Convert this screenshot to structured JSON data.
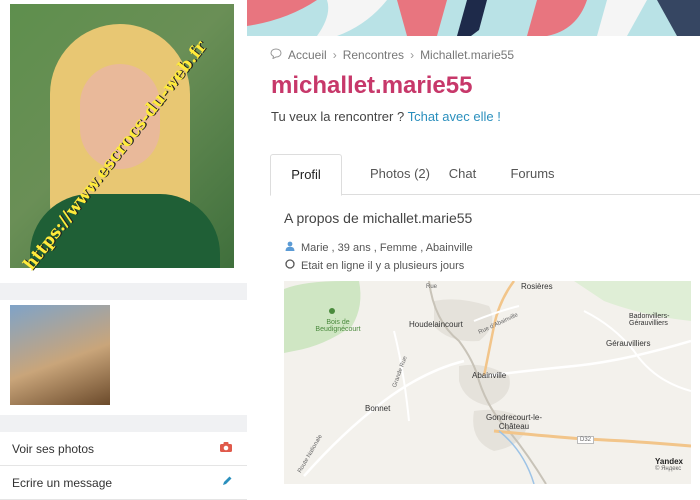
{
  "sidebar": {
    "watermark": "https://www.escrocs-du-web.fr",
    "actions": [
      {
        "label": "Voir ses photos",
        "icon": "camera-icon",
        "icon_color": "#e05a4b"
      },
      {
        "label": "Ecrire un message",
        "icon": "pencil-icon",
        "icon_color": "#2a8fbd"
      }
    ]
  },
  "breadcrumb": [
    "Accueil",
    "Rencontres",
    "Michallet.marie55"
  ],
  "profile": {
    "username": "michallet.marie55",
    "prompt": "Tu veux la rencontrer ?",
    "chat_link": "Tchat avec elle !",
    "about_title": "A propos de michallet.marie55",
    "details": "Marie , 39 ans , Femme , Abainville",
    "status": "Etait en ligne il y a plusieurs jours"
  },
  "tabs": [
    {
      "label": "Profil",
      "active": true
    },
    {
      "label": "Photos (2)",
      "active": false
    },
    {
      "label": "Chat",
      "active": false
    },
    {
      "label": "Forums",
      "active": false
    }
  ],
  "map": {
    "labels": {
      "rosieres": "Rosières",
      "bois": "Bois de Beudignécourt",
      "houdelaincourt": "Houdelaincourt",
      "rue_abainville": "Rue d'Abainville",
      "badonvillers": "Badonvillers-Gérauvilliers",
      "gerauvilliers": "Gérauvilliers",
      "grande_rue": "Grande Rue",
      "abainville": "Abainville",
      "bonnet": "Bonnet",
      "gondrecourt": "Gondrecourt-le-Château",
      "d32": "D32",
      "route_nationale": "Route Nationale",
      "rue": "Rue"
    },
    "provider": "Yandex",
    "provider_sub": "© Яндекс"
  },
  "colors": {
    "accent": "#c7386a",
    "link": "#2a8fbd",
    "icon_user": "#5b9bd5"
  }
}
